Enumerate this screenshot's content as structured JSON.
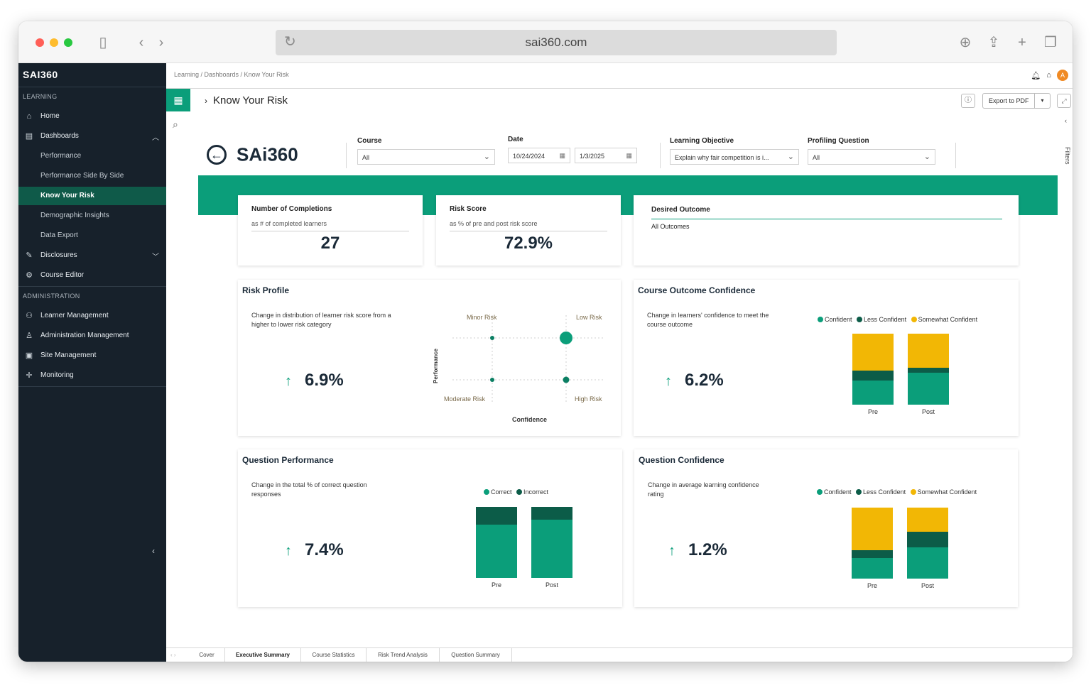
{
  "browser": {
    "url": "sai360.com"
  },
  "sidebar": {
    "logo": "SAI360",
    "section_learning": "LEARNING",
    "home": "Home",
    "dashboards": "Dashboards",
    "sub_items": [
      "Performance",
      "Performance Side By Side",
      "Know Your Risk",
      "Demographic Insights",
      "Data Export"
    ],
    "disclosures": "Disclosures",
    "course_editor": "Course Editor",
    "section_admin": "ADMINISTRATION",
    "learner_management": "Learner Management",
    "administration_management": "Administration Management",
    "site_management": "Site Management",
    "monitoring": "Monitoring"
  },
  "topbar": {
    "breadcrumb": "Learning / Dashboards / Know Your Risk"
  },
  "report": {
    "title": "Know Your Risk",
    "export_label": "Export to PDF",
    "filters_label": "Filters"
  },
  "filters": {
    "logo": "SAi360",
    "course": {
      "label": "Course",
      "value": "All"
    },
    "date": {
      "label": "Date",
      "from": "10/24/2024",
      "to": "1/3/2025"
    },
    "objective": {
      "label": "Learning Objective",
      "value": "Explain why fair competition is i..."
    },
    "profiling": {
      "label": "Profiling Question",
      "value": "All"
    }
  },
  "kpis": {
    "completions": {
      "title": "Number of Completions",
      "sub": "as # of completed learners",
      "value": "27"
    },
    "risk": {
      "title": "Risk Score",
      "sub": "as % of pre and post risk score",
      "value": "72.9%"
    },
    "outcome": {
      "title": "Desired Outcome",
      "value": "All Outcomes"
    }
  },
  "panels": {
    "risk_profile": {
      "title": "Risk Profile",
      "desc": "Change in distribution of learner risk score from a higher to lower risk category",
      "value": "6.9%",
      "quadrants": {
        "tl": "Minor Risk",
        "tr": "Low Risk",
        "bl": "Moderate Risk",
        "br": "High Risk"
      },
      "ylabel": "Performance",
      "xlabel": "Confidence"
    },
    "course_confidence": {
      "title": "Course Outcome Confidence",
      "desc": "Change in learners' confidence to meet the course outcome",
      "value": "6.2%"
    },
    "question_performance": {
      "title": "Question Performance",
      "desc": "Change in the total % of correct question responses",
      "value": "7.4%"
    },
    "question_confidence": {
      "title": "Question Confidence",
      "desc": "Change in average learning confidence rating",
      "value": "1.2%"
    }
  },
  "legend": {
    "confident": "Confident",
    "less_confident": "Less Confident",
    "somewhat_confident": "Somewhat Confident",
    "correct": "Correct",
    "incorrect": "Incorrect"
  },
  "colors": {
    "teal": "#0b9e7a",
    "dark_teal": "#0c5c48",
    "amber": "#f2b705",
    "sidebar": "#17212b"
  },
  "tabs": [
    "Cover",
    "Executive Summary",
    "Course Statistics",
    "Risk Trend Analysis",
    "Question Summary"
  ],
  "chart_data": [
    {
      "type": "scatter",
      "title": "Risk Profile",
      "xlabel": "Confidence",
      "ylabel": "Performance",
      "points": [
        {
          "x": 1,
          "y": 2,
          "size": 1,
          "label": "Minor Risk"
        },
        {
          "x": 2,
          "y": 2,
          "size": 3,
          "label": "Low Risk"
        },
        {
          "x": 1,
          "y": 1,
          "size": 1,
          "label": "Moderate Risk"
        },
        {
          "x": 2,
          "y": 1,
          "size": 1.5,
          "label": "High Risk"
        }
      ]
    },
    {
      "type": "bar",
      "stacked": true,
      "title": "Course Outcome Confidence",
      "categories": [
        "Pre",
        "Post"
      ],
      "series": [
        {
          "name": "Confident",
          "color": "#0b9e7a",
          "values": [
            34,
            45
          ]
        },
        {
          "name": "Less Confident",
          "color": "#0c5c48",
          "values": [
            14,
            7
          ]
        },
        {
          "name": "Somewhat Confident",
          "color": "#f2b705",
          "values": [
            52,
            48
          ]
        }
      ],
      "ylim": [
        0,
        100
      ]
    },
    {
      "type": "bar",
      "stacked": true,
      "title": "Question Performance",
      "categories": [
        "Pre",
        "Post"
      ],
      "series": [
        {
          "name": "Correct",
          "color": "#0b9e7a",
          "values": [
            75,
            82
          ]
        },
        {
          "name": "Incorrect",
          "color": "#0c5c48",
          "values": [
            25,
            18
          ]
        }
      ],
      "ylim": [
        0,
        100
      ]
    },
    {
      "type": "bar",
      "stacked": true,
      "title": "Question Confidence",
      "categories": [
        "Pre",
        "Post"
      ],
      "series": [
        {
          "name": "Confident",
          "color": "#0b9e7a",
          "values": [
            29,
            44
          ]
        },
        {
          "name": "Less Confident",
          "color": "#0c5c48",
          "values": [
            11,
            22
          ]
        },
        {
          "name": "Somewhat Confident",
          "color": "#f2b705",
          "values": [
            60,
            34
          ]
        }
      ],
      "ylim": [
        0,
        100
      ]
    }
  ]
}
